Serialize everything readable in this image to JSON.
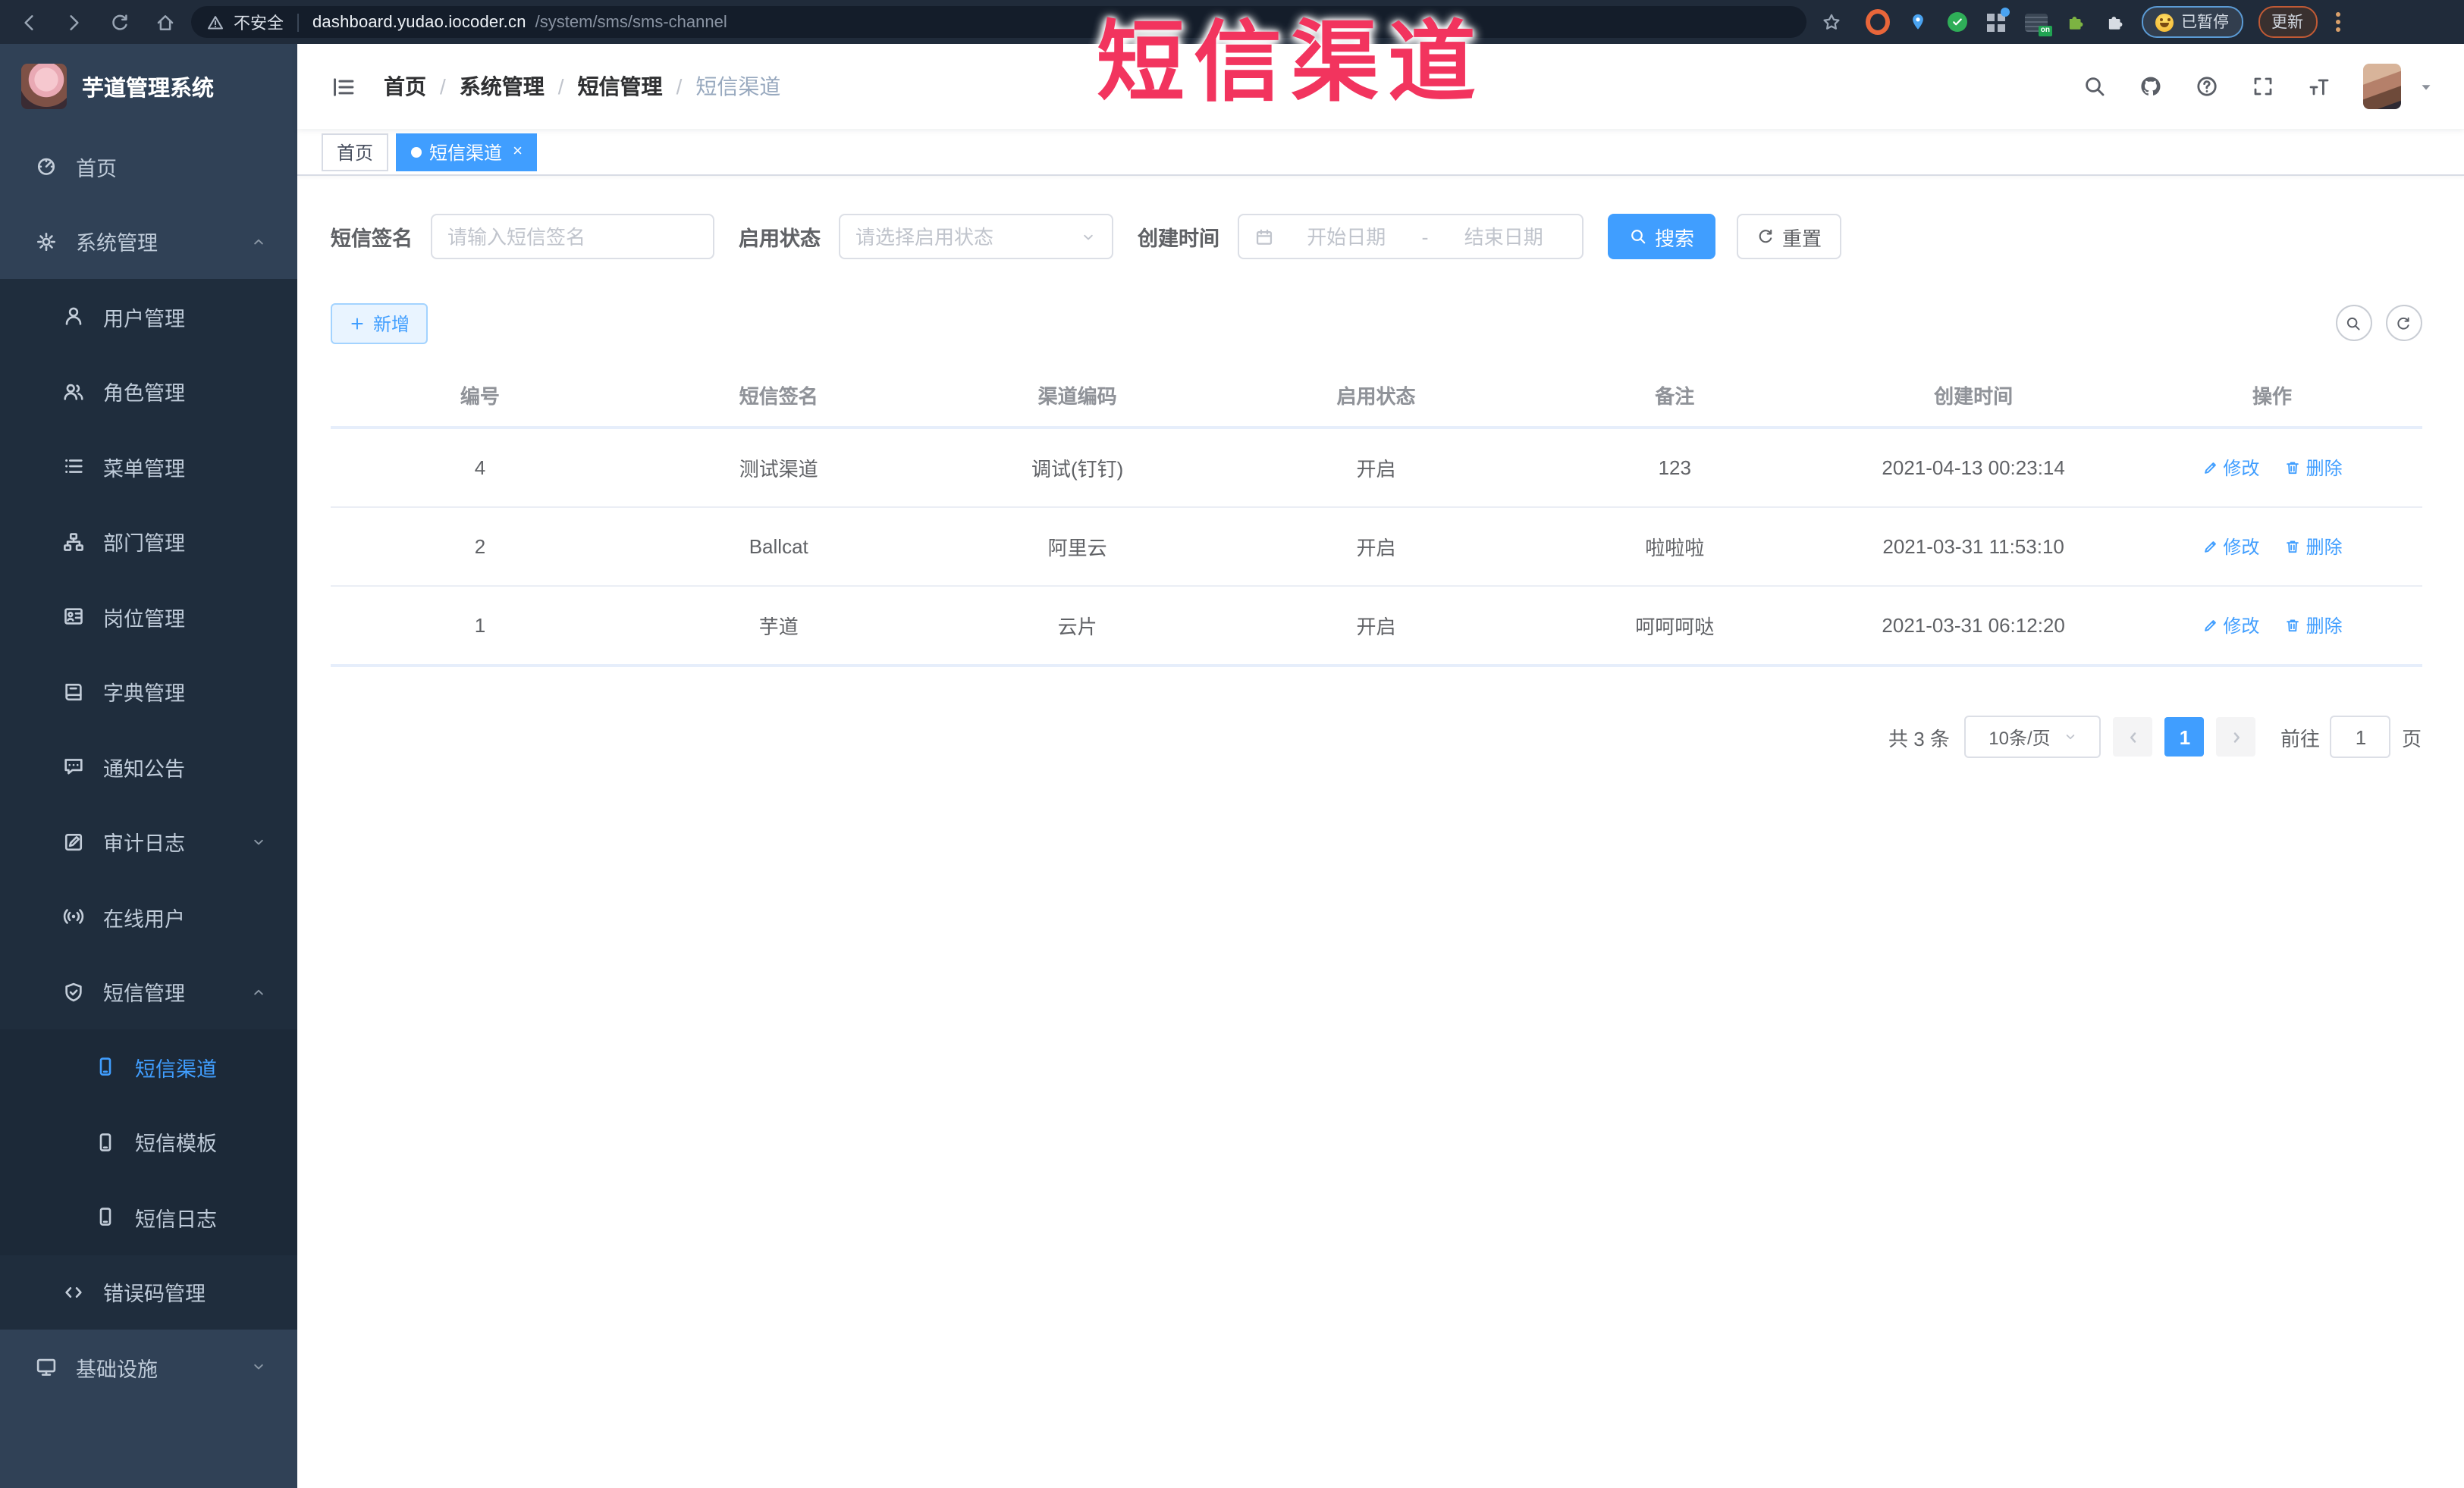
{
  "browser": {
    "security_label": "不安全",
    "url_host": "dashboard.yudao.iocoder.cn",
    "url_path": "/system/sms/sms-channel",
    "on_badge": "on",
    "paused_badge": "已暂停",
    "update_button": "更新"
  },
  "overlay_title": "短信渠道",
  "sidebar": {
    "logo_title": "芋道管理系统",
    "items": [
      {
        "label": "首页"
      },
      {
        "label": "系统管理"
      },
      {
        "label": "用户管理"
      },
      {
        "label": "角色管理"
      },
      {
        "label": "菜单管理"
      },
      {
        "label": "部门管理"
      },
      {
        "label": "岗位管理"
      },
      {
        "label": "字典管理"
      },
      {
        "label": "通知公告"
      },
      {
        "label": "审计日志"
      },
      {
        "label": "在线用户"
      },
      {
        "label": "短信管理"
      },
      {
        "label": "短信渠道"
      },
      {
        "label": "短信模板"
      },
      {
        "label": "短信日志"
      },
      {
        "label": "错误码管理"
      },
      {
        "label": "基础设施"
      }
    ]
  },
  "header": {
    "breadcrumbs": [
      "首页",
      "系统管理",
      "短信管理",
      "短信渠道"
    ],
    "separator": "/"
  },
  "tabs": {
    "home": "首页",
    "current": "短信渠道",
    "close": "×"
  },
  "filters": {
    "sign_label": "短信签名",
    "sign_placeholder": "请输入短信签名",
    "status_label": "启用状态",
    "status_placeholder": "请选择启用状态",
    "time_label": "创建时间",
    "start_placeholder": "开始日期",
    "range_separator": "-",
    "end_placeholder": "结束日期",
    "search_button": "搜索",
    "reset_button": "重置"
  },
  "toolbar": {
    "add_button": "新增"
  },
  "table": {
    "columns": [
      "编号",
      "短信签名",
      "渠道编码",
      "启用状态",
      "备注",
      "创建时间",
      "操作"
    ],
    "rows": [
      {
        "id": "4",
        "sign": "测试渠道",
        "code": "调试(钉钉)",
        "status": "开启",
        "remark": "123",
        "created": "2021-04-13 00:23:14"
      },
      {
        "id": "2",
        "sign": "Ballcat",
        "code": "阿里云",
        "status": "开启",
        "remark": "啦啦啦",
        "created": "2021-03-31 11:53:10"
      },
      {
        "id": "1",
        "sign": "芋道",
        "code": "云片",
        "status": "开启",
        "remark": "呵呵呵哒",
        "created": "2021-03-31 06:12:20"
      }
    ],
    "edit_label": "修改",
    "delete_label": "删除"
  },
  "pagination": {
    "total_text": "共 3 条",
    "page_size": "10条/页",
    "current_page": "1",
    "goto_label": "前往",
    "goto_value": "1",
    "page_unit": "页"
  },
  "colors": {
    "primary": "#409eff",
    "overlay_red": "#f2345e",
    "sidebar_bg": "#304156",
    "sidebar_sub_bg": "#1f2d3d",
    "browser_bar": "#202b3a"
  }
}
